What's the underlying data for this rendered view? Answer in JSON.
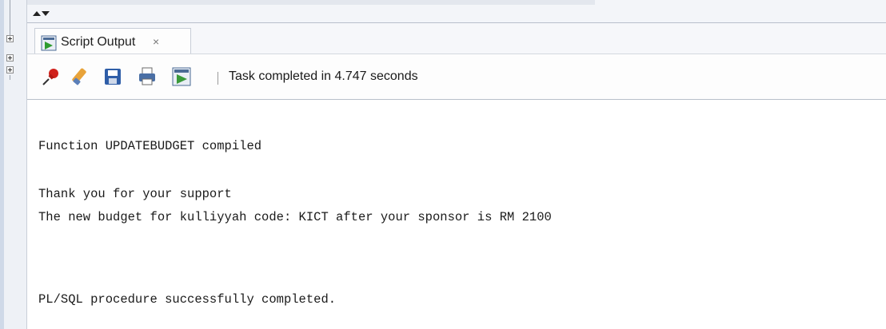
{
  "tab": {
    "label": "Script Output",
    "close_glyph": "×",
    "icon": "script-output-icon"
  },
  "toolbar": {
    "buttons": [
      {
        "name": "pin-icon",
        "color": "#d0211b"
      },
      {
        "name": "eraser-icon",
        "color": "#e8a33a"
      },
      {
        "name": "save-icon",
        "color": "#2f5ea8"
      },
      {
        "name": "print-icon",
        "color": "#4a6fa5"
      },
      {
        "name": "run-script-icon",
        "color": "#3a9a3a"
      }
    ],
    "status": "Task completed in 4.747 seconds"
  },
  "output": {
    "lines": [
      "Function UPDATEBUDGET compiled",
      "Thank you for your support",
      "The new budget for kulliyyah code: KICT after your sponsor is RM 2100",
      "PL/SQL procedure successfully completed."
    ]
  }
}
